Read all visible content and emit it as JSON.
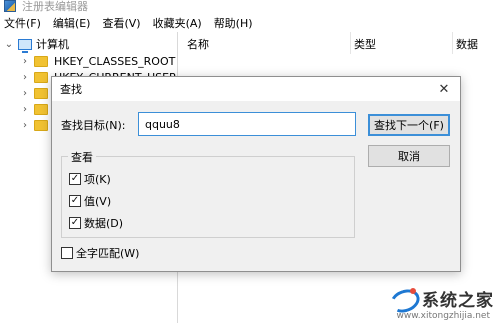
{
  "window": {
    "title": "注册表编辑器"
  },
  "menubar": {
    "items": [
      "文件(F)",
      "编辑(E)",
      "查看(V)",
      "收藏夹(A)",
      "帮助(H)"
    ]
  },
  "tree": {
    "root": {
      "label": "计算机",
      "icon": "computer-icon",
      "expanded": true
    },
    "children": [
      {
        "label": "HKEY_CLASSES_ROOT",
        "icon": "folder-icon"
      },
      {
        "label": "HKEY_CURRENT_USER",
        "icon": "folder-icon"
      },
      {
        "label": "",
        "icon": "folder-icon"
      },
      {
        "label": "",
        "icon": "folder-icon"
      },
      {
        "label": "",
        "icon": "folder-icon"
      }
    ]
  },
  "list": {
    "columns": [
      "名称",
      "类型",
      "数据"
    ]
  },
  "find_dialog": {
    "title": "查找",
    "close_icon": "close-icon",
    "find_label": "查找目标(N):",
    "find_value": "qquu8",
    "find_next_button": "查找下一个(F)",
    "cancel_button": "取消",
    "look_at_group": "查看",
    "options": [
      {
        "label": "项(K)",
        "checked": true
      },
      {
        "label": "值(V)",
        "checked": true
      },
      {
        "label": "数据(D)",
        "checked": true
      }
    ],
    "match_whole": {
      "label": "全字匹配(W)",
      "checked": false
    }
  },
  "watermark": {
    "brand": "系统之家",
    "url": "www.xitongzhijia.net"
  },
  "colors": {
    "accent": "#3c8fd8",
    "dialog_bg": "#f0f0f0",
    "folder": "#f1c232"
  }
}
